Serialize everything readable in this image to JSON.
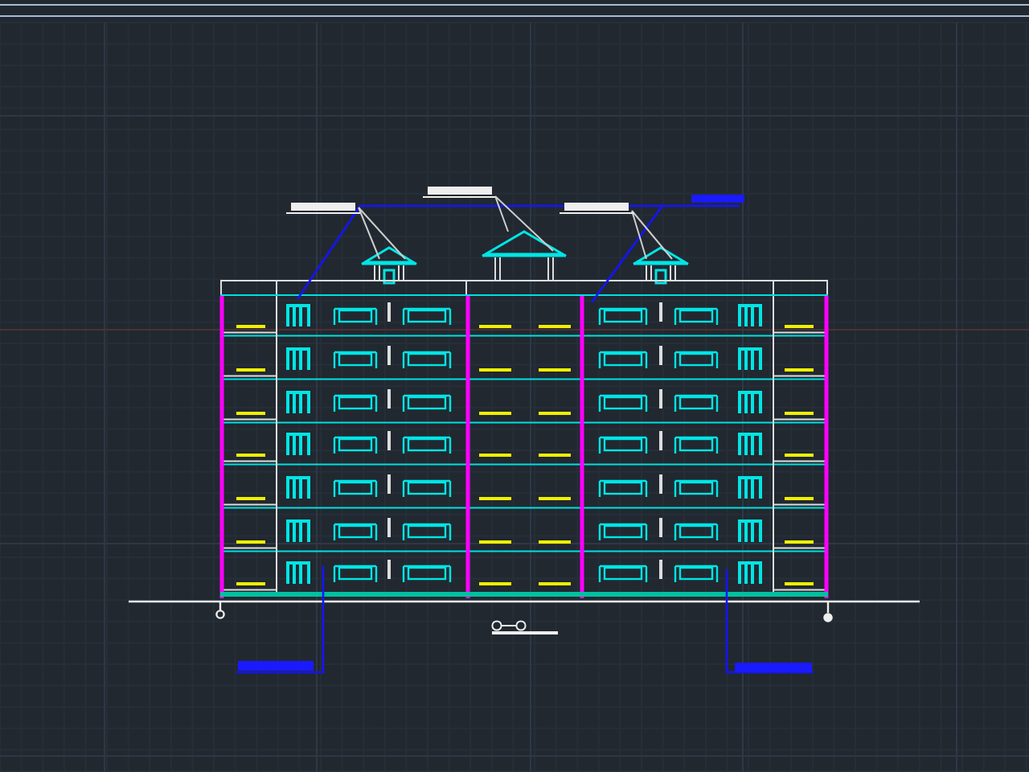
{
  "viewport": {
    "kind": "cad-elevation"
  }
}
